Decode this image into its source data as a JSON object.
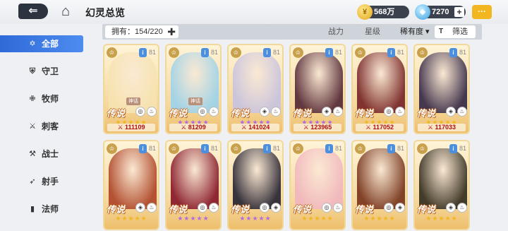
{
  "header": {
    "back_icon": "back-arrow-icon",
    "home_icon": "home-icon",
    "title": "幻灵总览",
    "gold": "568万",
    "gems": "7270",
    "add_label": "+",
    "chat_icon": "chat-bubble-icon"
  },
  "filterbar": {
    "owned": "拥有：154/220",
    "owned_add": "✚",
    "sort_power": "战力",
    "sort_star": "星级",
    "sort_rarity": "稀有度 ▾",
    "filter": "筛选",
    "filter_icon": "T"
  },
  "sidebar": {
    "items": [
      {
        "label": "全部",
        "icon": "star-of-david-icon",
        "glyph": "✡"
      },
      {
        "label": "守卫",
        "icon": "shield-icon",
        "glyph": "⛨"
      },
      {
        "label": "牧师",
        "icon": "healer-icon",
        "glyph": "✙"
      },
      {
        "label": "刺客",
        "icon": "dagger-icon",
        "glyph": "⚔"
      },
      {
        "label": "战士",
        "icon": "axe-icon",
        "glyph": "⚒"
      },
      {
        "label": "射手",
        "icon": "bow-icon",
        "glyph": "➶"
      },
      {
        "label": "法师",
        "icon": "spellbook-icon",
        "glyph": "▮"
      }
    ]
  },
  "cards": [
    {
      "level": "81",
      "rarity": "传说",
      "tag": "神话",
      "power": "111109",
      "stars": "★★★★★",
      "star_color": "#f2b620",
      "portrait_color": "#f6e3b0",
      "elem1": "◎",
      "elem2": "♨"
    },
    {
      "level": "81",
      "rarity": "传说",
      "tag": "神话",
      "power": "81209",
      "stars": "★★★★★",
      "star_color": "#b46ae0",
      "portrait_color": "#9fd3e8",
      "elem1": "◎",
      "elem2": "♨"
    },
    {
      "level": "81",
      "rarity": "传说",
      "tag": "",
      "power": "141024",
      "stars": "★★★★★",
      "star_color": "#b46ae0",
      "portrait_color": "#c9c4de",
      "elem1": "◈",
      "elem2": "♨"
    },
    {
      "level": "81",
      "rarity": "传说",
      "tag": "",
      "power": "123965",
      "stars": "★★★★★",
      "star_color": "#b46ae0",
      "portrait_color": "#5a2f3a",
      "elem1": "◈",
      "elem2": "♨"
    },
    {
      "level": "81",
      "rarity": "传说",
      "tag": "",
      "power": "117052",
      "stars": "★★★★★",
      "star_color": "#f2b620",
      "portrait_color": "#7a2a2a",
      "elem1": "◎",
      "elem2": "♨"
    },
    {
      "level": "81",
      "rarity": "传说",
      "tag": "",
      "power": "117033",
      "stars": "★★★★★",
      "star_color": "#f2b620",
      "portrait_color": "#3c2f4a",
      "elem1": "◈",
      "elem2": "♨"
    },
    {
      "level": "81",
      "rarity": "传说",
      "tag": "",
      "power": "",
      "stars": "★★★★★",
      "star_color": "#f2b620",
      "portrait_color": "#b04a2c",
      "elem1": "◈",
      "elem2": "♨"
    },
    {
      "level": "81",
      "rarity": "传说",
      "tag": "",
      "power": "",
      "stars": "★★★★★",
      "star_color": "#b46ae0",
      "portrait_color": "#8a1f2e",
      "elem1": "◎",
      "elem2": "♨"
    },
    {
      "level": "81",
      "rarity": "传说",
      "tag": "",
      "power": "",
      "stars": "★★★★★",
      "star_color": "#b46ae0",
      "portrait_color": "#2e2a36",
      "elem1": "◎",
      "elem2": "◈"
    },
    {
      "level": "81",
      "rarity": "传说",
      "tag": "",
      "power": "",
      "stars": "★★★★★",
      "star_color": "#f2b620",
      "portrait_color": "#f1b7bd",
      "elem1": "◎",
      "elem2": "♨"
    },
    {
      "level": "81",
      "rarity": "传说",
      "tag": "",
      "power": "",
      "stars": "★★★★★",
      "star_color": "#f2b620",
      "portrait_color": "#7b3a22",
      "elem1": "◎",
      "elem2": "◈"
    },
    {
      "level": "81",
      "rarity": "传说",
      "tag": "",
      "power": "",
      "stars": "★★★★★",
      "star_color": "#f2b620",
      "portrait_color": "#3a3324",
      "elem1": "◈",
      "elem2": "♨"
    }
  ]
}
